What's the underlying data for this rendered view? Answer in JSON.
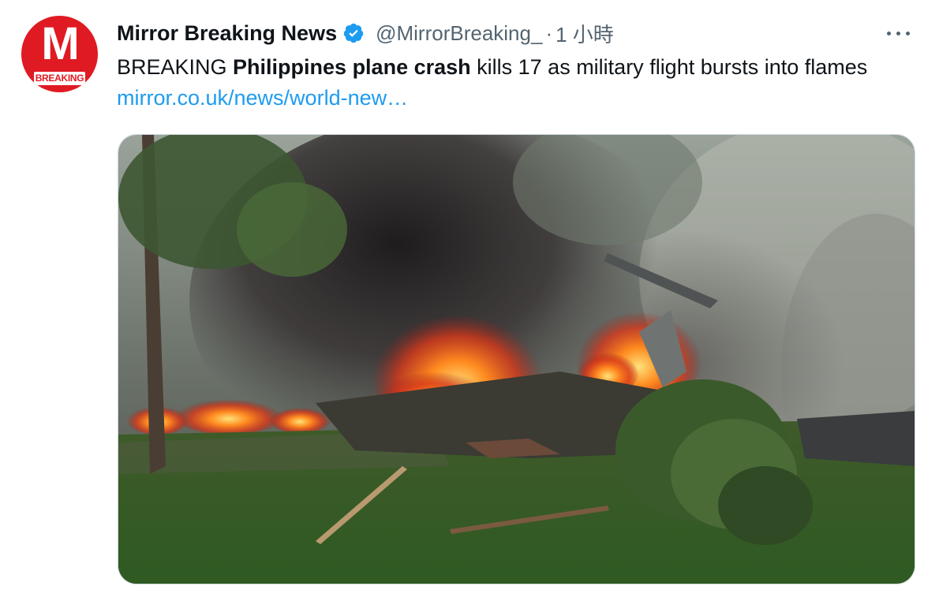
{
  "tweet": {
    "avatar": {
      "letter": "M",
      "badge_text": "BREAKING",
      "color": "#e01a22"
    },
    "display_name": "Mirror Breaking News",
    "verified_icon": "verified-badge-icon",
    "handle": "@MirrorBreaking_",
    "separator": "·",
    "time": "1 小時",
    "more_icon": "more-horizontal-icon",
    "text": {
      "prefix": "BREAKING ",
      "bold": "Philippines plane crash",
      "suffix": " kills 17 as military flight bursts into flames ",
      "link": "mirror.co.uk/news/world-new…"
    },
    "media": {
      "alt": "photo"
    }
  },
  "colors": {
    "link": "#1d9bf0",
    "secondary_text": "#536471",
    "verified": "#1d9bf0",
    "border": "#cfd9de"
  }
}
